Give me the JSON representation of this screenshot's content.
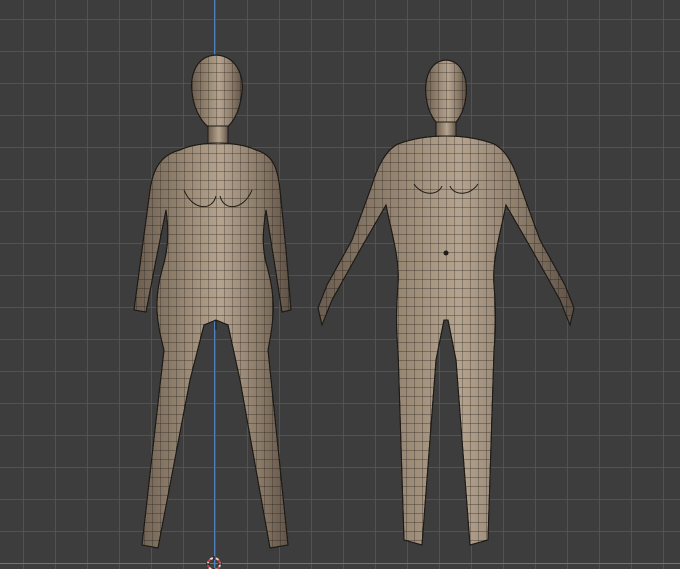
{
  "viewport": {
    "background_color": "#3d3d3d",
    "grid_color": "#555555",
    "y_axis_color": "#4f86c6",
    "x_axis_color": "#c05b5b",
    "mesh_fill": "#8a7a68",
    "mesh_wire": "#1e1a16",
    "mesh_highlight": "#b3a38f"
  },
  "figures": [
    {
      "name": "female-base-mesh",
      "icon": "female-figure"
    },
    {
      "name": "male-base-mesh",
      "icon": "male-figure"
    }
  ],
  "cursor": {
    "icon": "3d-cursor-icon"
  }
}
